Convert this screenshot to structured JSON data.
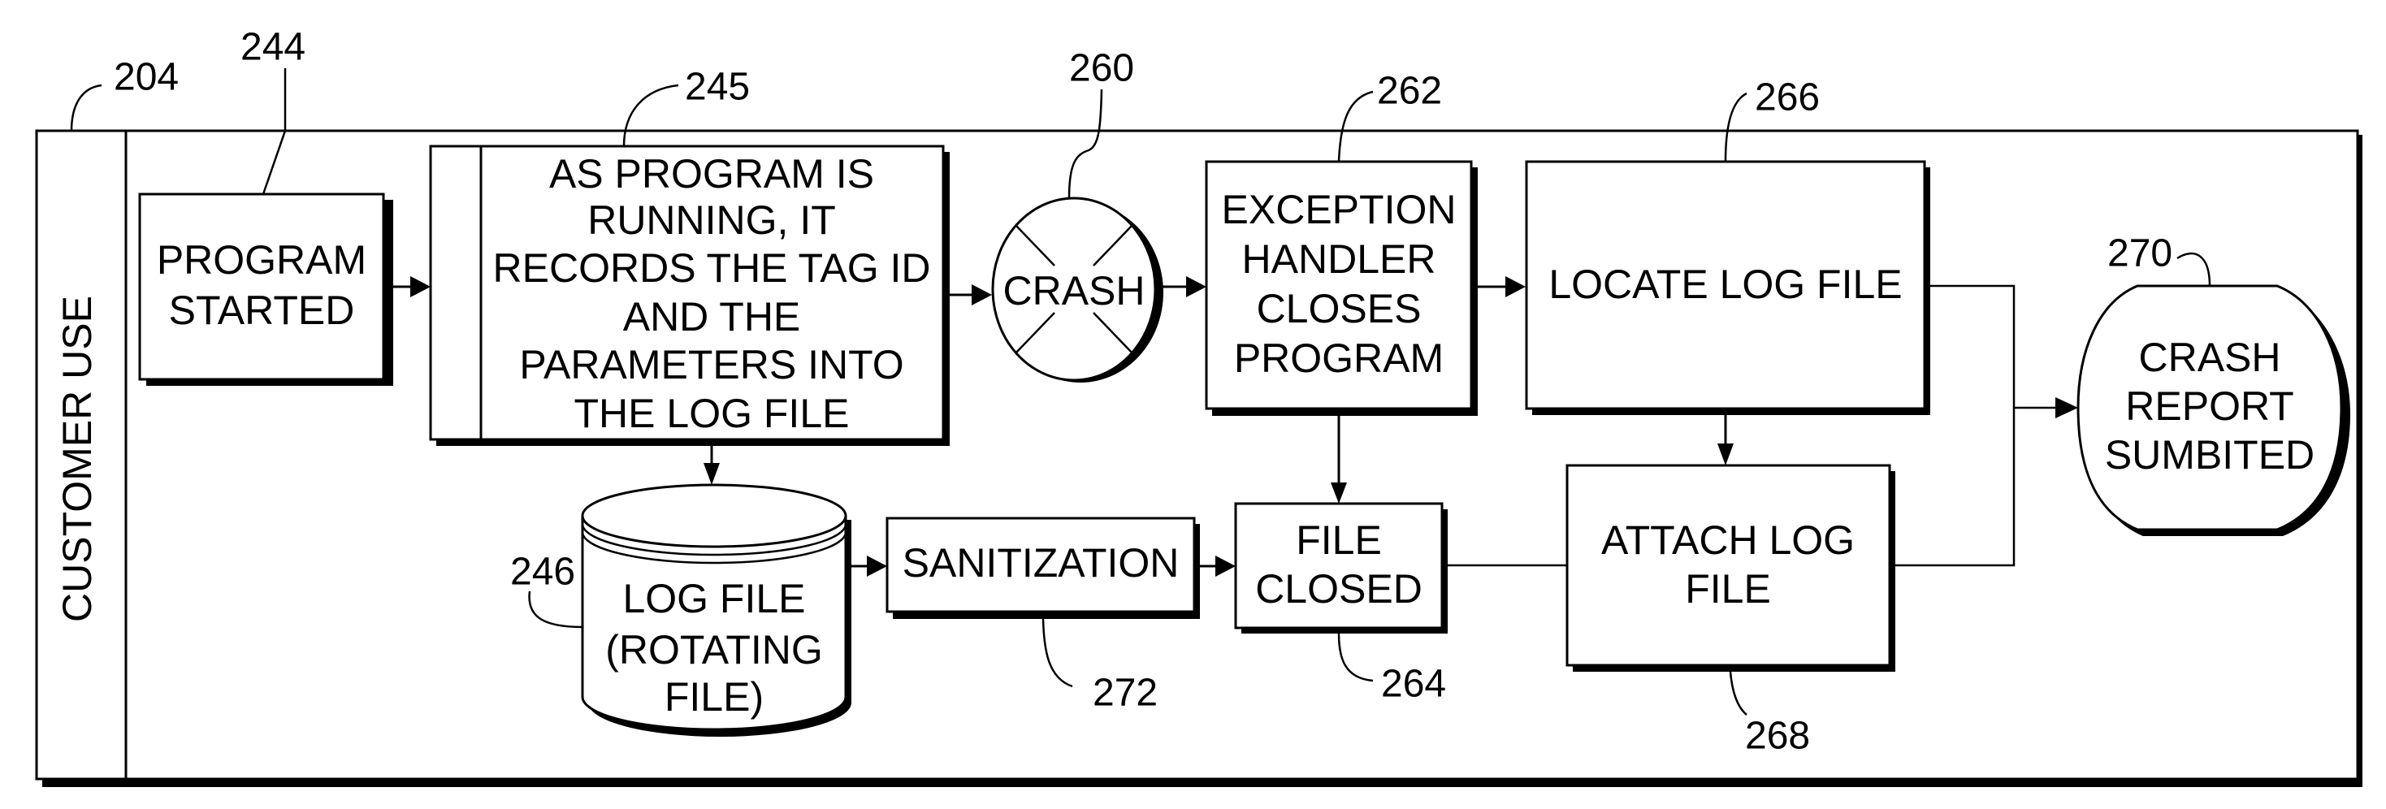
{
  "diagram": {
    "lane": {
      "ref": "204",
      "label": "CUSTOMER USE"
    },
    "nodes": {
      "program_started": {
        "ref": "244",
        "lines": [
          "PROGRAM",
          "STARTED"
        ]
      },
      "record_log": {
        "ref": "245",
        "lines": [
          "AS PROGRAM IS",
          "RUNNING, IT",
          "RECORDS THE TAG ID",
          "AND THE",
          "PARAMETERS INTO",
          "THE LOG FILE"
        ]
      },
      "log_file": {
        "ref": "246",
        "lines": [
          "LOG FILE",
          "(ROTATING",
          "FILE)"
        ]
      },
      "crash": {
        "ref": "260",
        "lines": [
          "CRASH"
        ]
      },
      "exception_handler": {
        "ref": "262",
        "lines": [
          "EXCEPTION",
          "HANDLER",
          "CLOSES",
          "PROGRAM"
        ]
      },
      "file_closed": {
        "ref": "264",
        "lines": [
          "FILE",
          "CLOSED"
        ]
      },
      "locate_log": {
        "ref": "266",
        "lines": [
          "LOCATE LOG FILE"
        ]
      },
      "attach_log": {
        "ref": "268",
        "lines": [
          "ATTACH LOG",
          "FILE"
        ]
      },
      "crash_report": {
        "ref": "270",
        "lines": [
          "CRASH",
          "REPORT",
          "SUMBITED"
        ]
      },
      "sanitization": {
        "ref": "272",
        "lines": [
          "SANITIZATION"
        ]
      }
    },
    "edges": [
      {
        "from": "244",
        "to": "245"
      },
      {
        "from": "245",
        "to": "260"
      },
      {
        "from": "245",
        "to": "246"
      },
      {
        "from": "246",
        "to": "272"
      },
      {
        "from": "272",
        "to": "264"
      },
      {
        "from": "260",
        "to": "262"
      },
      {
        "from": "262",
        "to": "266"
      },
      {
        "from": "262",
        "to": "264"
      },
      {
        "from": "266",
        "to": "268"
      },
      {
        "from": "266",
        "to": "270"
      },
      {
        "from": "264",
        "to": "268"
      },
      {
        "from": "268",
        "to": "270"
      }
    ]
  }
}
